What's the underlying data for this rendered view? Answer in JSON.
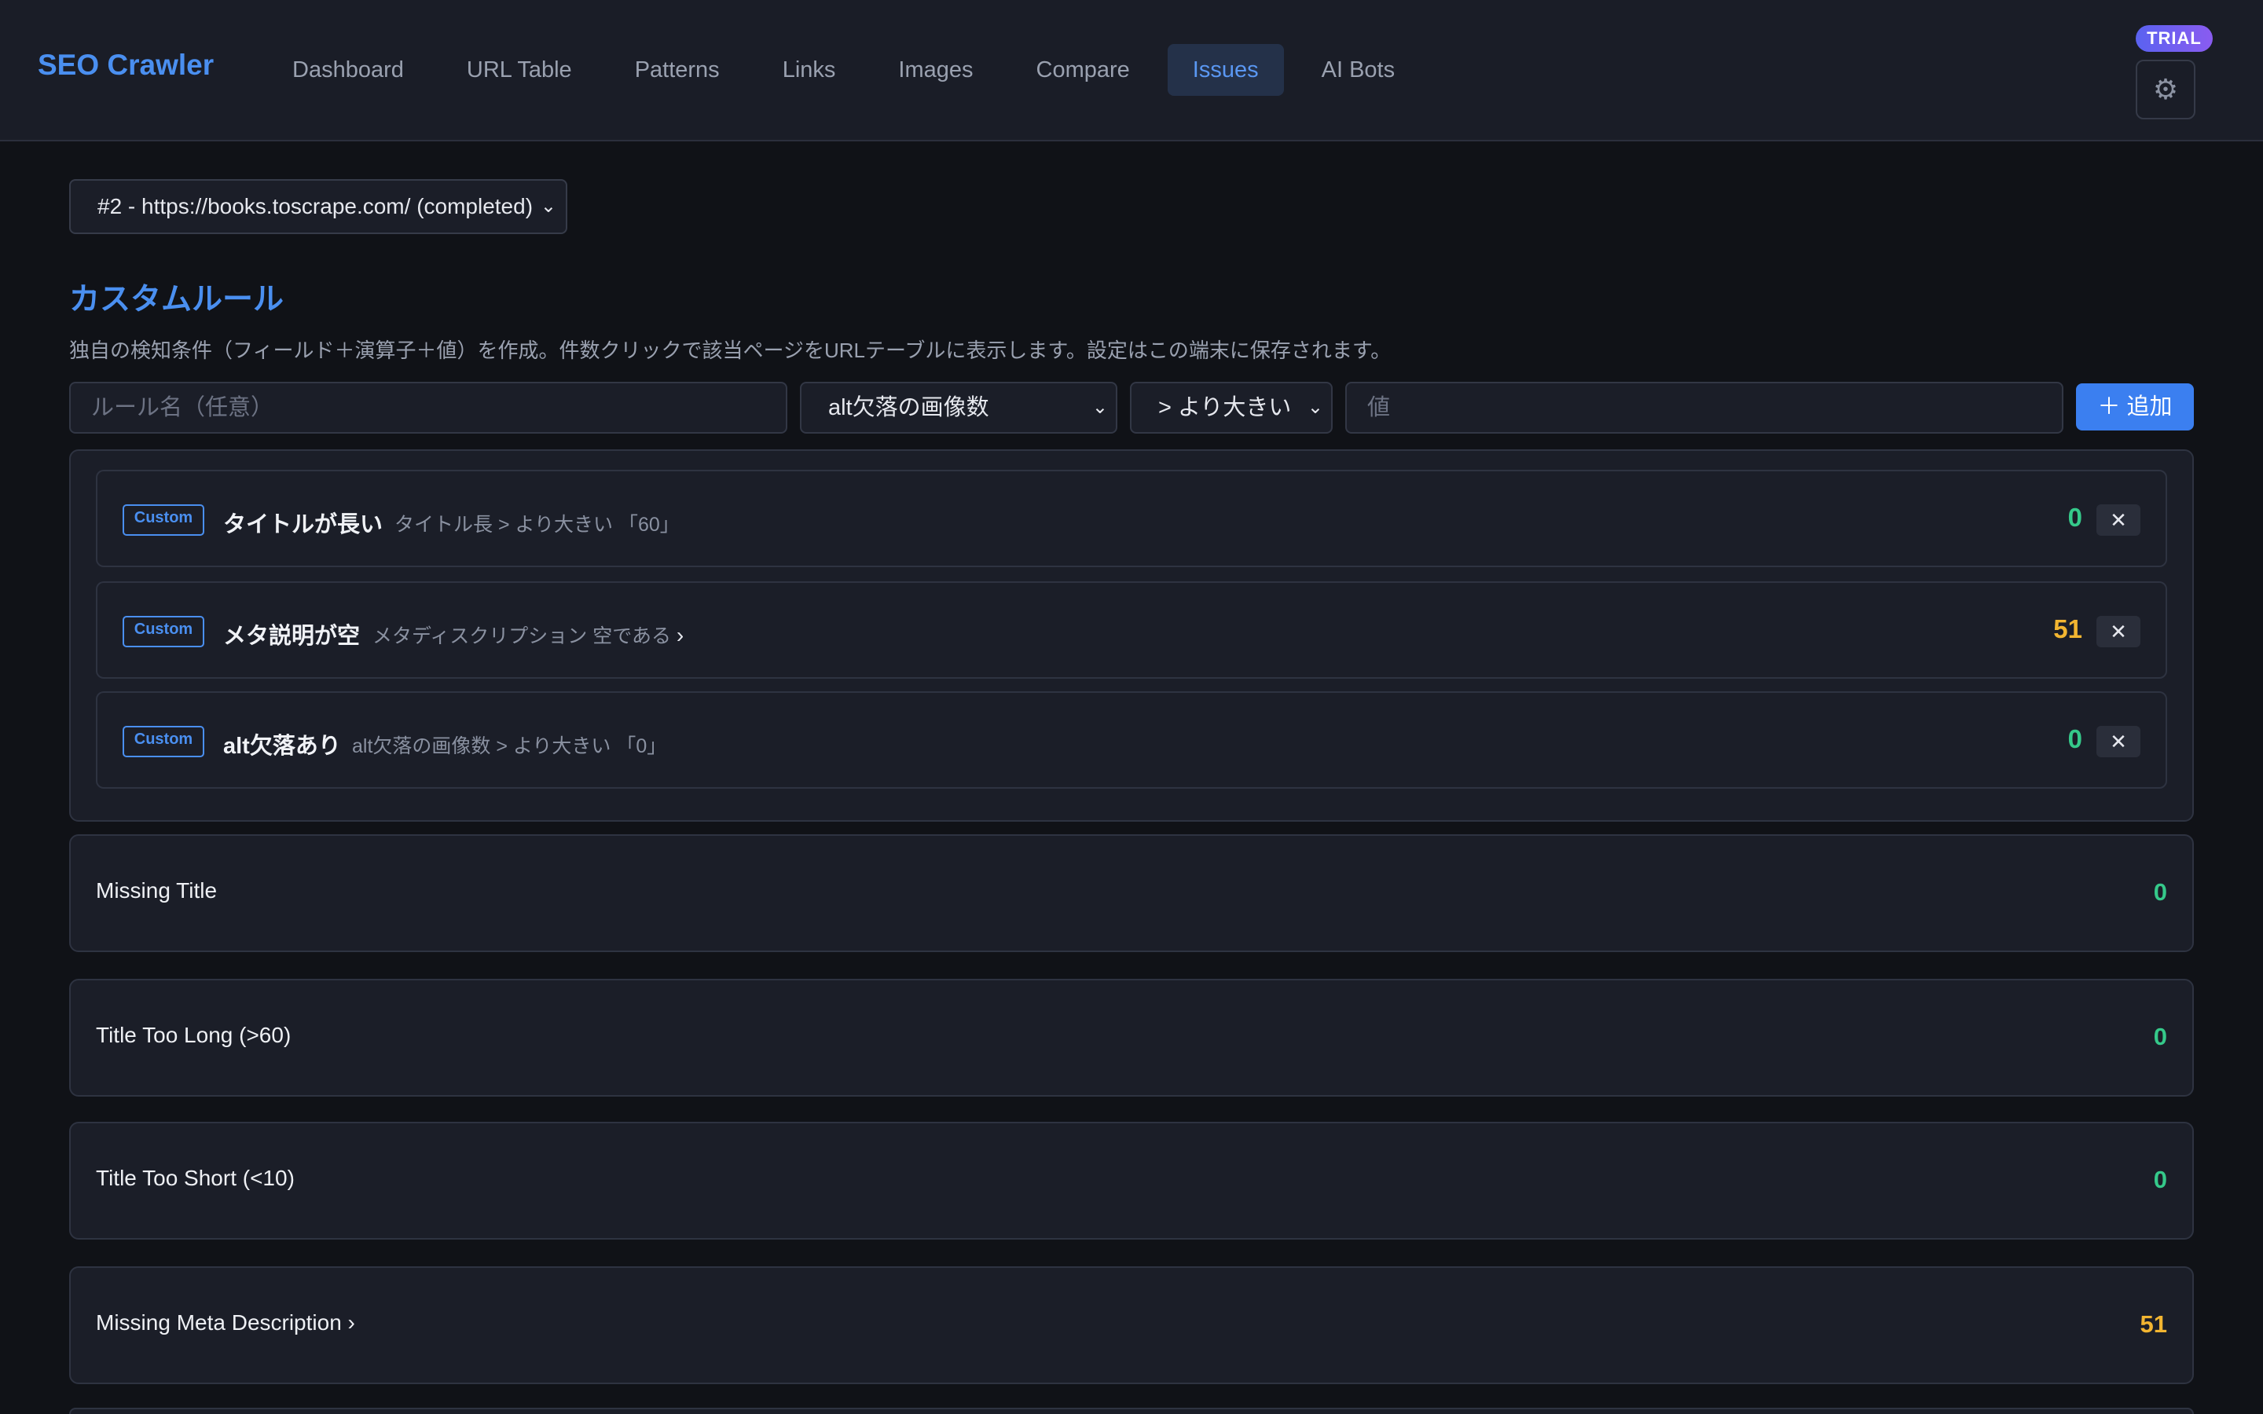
{
  "app": {
    "brand": "SEO Crawler",
    "trial_badge": "TRIAL",
    "settings_icon": "gear-icon"
  },
  "nav": {
    "items": [
      {
        "label": "Dashboard",
        "active": false
      },
      {
        "label": "URL Table",
        "active": false
      },
      {
        "label": "Patterns",
        "active": false
      },
      {
        "label": "Links",
        "active": false
      },
      {
        "label": "Images",
        "active": false
      },
      {
        "label": "Compare",
        "active": false
      },
      {
        "label": "Issues",
        "active": true
      },
      {
        "label": "AI Bots",
        "active": false
      }
    ]
  },
  "crawl_selector": {
    "value": "#2 - https://books.toscrape.com/ (completed)"
  },
  "custom_rules": {
    "title": "カスタムルール",
    "description": "独自の検知条件（フィールド＋演算子＋値）を作成。件数クリックで該当ページをURLテーブルに表示します。設定はこの端末に保存されます。",
    "form": {
      "name_placeholder": "ルール名（任意）",
      "field_value": "alt欠落の画像数",
      "operator_value": "> より大きい",
      "value_placeholder": "値",
      "add_label": "＋ 追加"
    },
    "rules": [
      {
        "tag": "Custom",
        "name": "タイトルが長い",
        "condition": "タイトル長 > より大きい 「60」",
        "link": "",
        "count": "0",
        "count_color": "#35c98a",
        "delete": "✕"
      },
      {
        "tag": "Custom",
        "name": "メタ説明が空",
        "condition": "メタディスクリプション 空である",
        "link": "›",
        "count": "51",
        "count_color": "#f2b531",
        "delete": "✕"
      },
      {
        "tag": "Custom",
        "name": "alt欠落あり",
        "condition": "alt欠落の画像数 > より大きい 「0」",
        "link": "",
        "count": "0",
        "count_color": "#35c98a",
        "delete": "✕"
      }
    ]
  },
  "issues": [
    {
      "label": "Missing Title",
      "count": "0",
      "count_color": "#35c98a"
    },
    {
      "label": "Title Too Long (>60)",
      "count": "0",
      "count_color": "#35c98a"
    },
    {
      "label": "Title Too Short (<10)",
      "count": "0",
      "count_color": "#35c98a"
    },
    {
      "label": "Missing Meta Description ›",
      "count": "51",
      "count_color": "#f2b531"
    }
  ],
  "colors": {
    "accent": "#4a8ff0",
    "ok": "#35c98a",
    "warn": "#f2b531",
    "background": "#101217",
    "card": "#1b1e28"
  }
}
